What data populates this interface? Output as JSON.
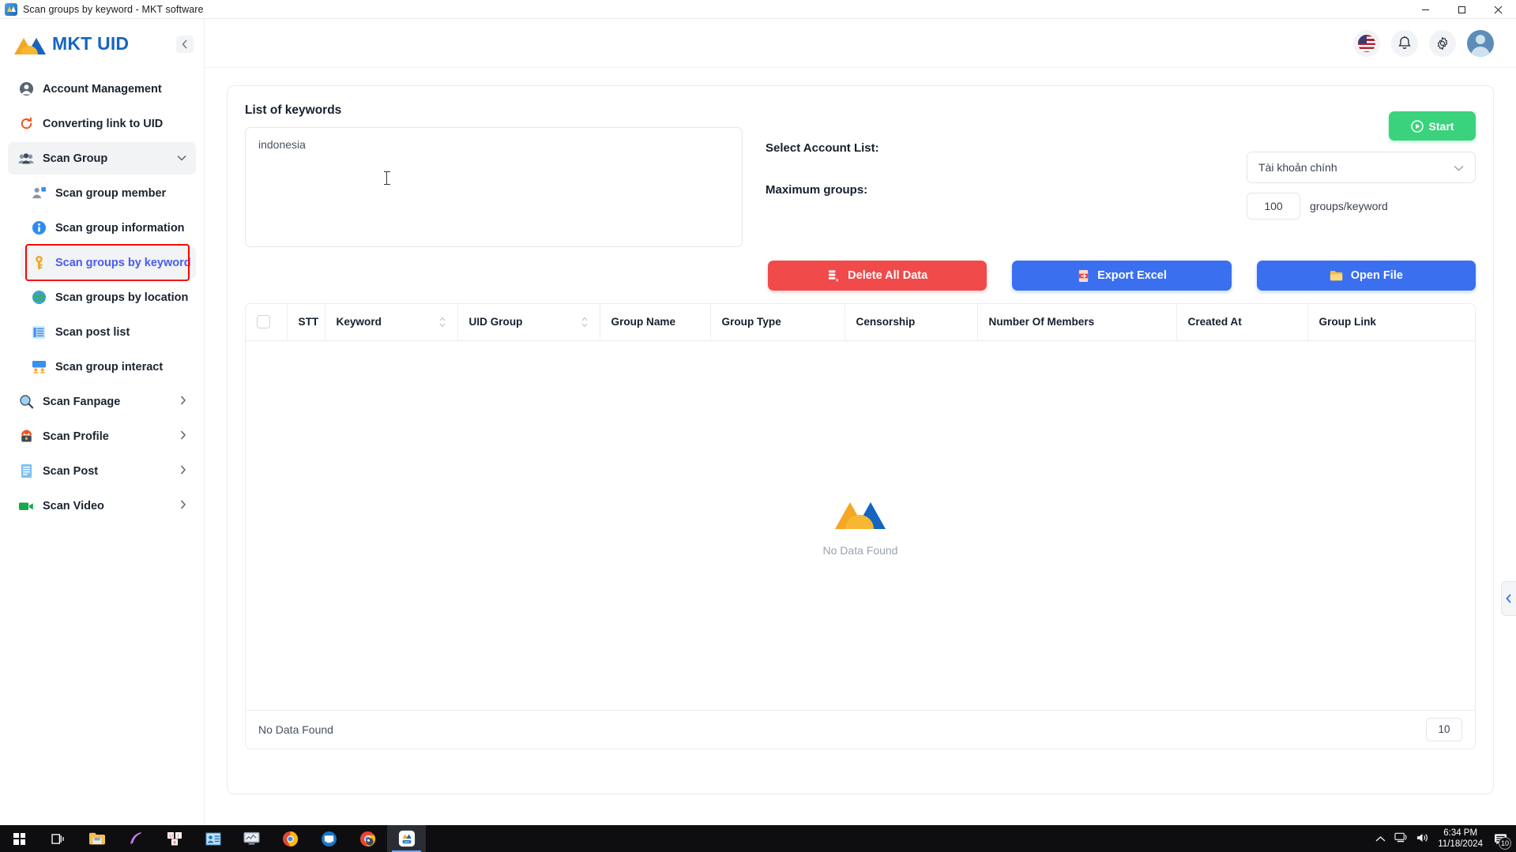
{
  "window": {
    "title": "Scan groups by keyword - MKT software",
    "icon": "app-icon",
    "controls": {
      "minimize": "–",
      "maximize": "□",
      "close": "✕"
    }
  },
  "sidebar": {
    "brand": "MKT UID",
    "collapse_icon": "chevron-left-icon",
    "items": [
      {
        "label": "Account Management",
        "icon": "user-circle-icon",
        "level": "top",
        "state": "normal"
      },
      {
        "label": "Converting link to UID",
        "icon": "refresh-icon",
        "level": "top",
        "state": "normal"
      },
      {
        "label": "Scan Group",
        "icon": "group-icon",
        "level": "top",
        "state": "expanded",
        "chevron": "chevron-down-icon"
      },
      {
        "label": "Scan group member",
        "icon": "user-plus-icon",
        "level": "sub",
        "state": "normal"
      },
      {
        "label": "Scan group information",
        "icon": "info-icon",
        "level": "sub",
        "state": "normal"
      },
      {
        "label": "Scan groups by keyword",
        "icon": "key-icon",
        "level": "sub",
        "state": "selected"
      },
      {
        "label": "Scan groups by location",
        "icon": "globe-icon",
        "level": "sub",
        "state": "normal"
      },
      {
        "label": "Scan post list",
        "icon": "list-icon",
        "level": "sub",
        "state": "normal"
      },
      {
        "label": "Scan group interact",
        "icon": "interact-icon",
        "level": "sub",
        "state": "normal"
      },
      {
        "label": "Scan Fanpage",
        "icon": "magnifier-icon",
        "level": "top",
        "state": "collapsed",
        "chevron": "chevron-right-icon"
      },
      {
        "label": "Scan Profile",
        "icon": "profile-lock-icon",
        "level": "top",
        "state": "collapsed",
        "chevron": "chevron-right-icon"
      },
      {
        "label": "Scan Post",
        "icon": "document-icon",
        "level": "top",
        "state": "collapsed",
        "chevron": "chevron-right-icon"
      },
      {
        "label": "Scan Video",
        "icon": "video-camera-icon",
        "level": "top",
        "state": "collapsed",
        "chevron": "chevron-right-icon"
      }
    ]
  },
  "topbar": {
    "language_flag": "us-flag-icon",
    "notification_icon": "bell-icon",
    "settings_icon": "gear-icon",
    "avatar_icon": "user-avatar-icon"
  },
  "main": {
    "keywords_title": "List of keywords",
    "keywords_value": "indonesia",
    "account_label": "Select Account List:",
    "account_selected": "Tài khoản chính",
    "account_chevron": "chevron-down-icon",
    "max_groups_label": "Maximum groups:",
    "max_groups_value": "100",
    "max_groups_suffix": "groups/keyword",
    "start_label": "Start",
    "start_icon": "play-circle-icon",
    "buttons": [
      {
        "label": "Delete All Data",
        "icon": "delete-data-icon",
        "color": "#f04a4a"
      },
      {
        "label": "Export Excel",
        "icon": "export-excel-icon",
        "color": "#3a6ff0"
      },
      {
        "label": "Open File",
        "icon": "folder-icon",
        "color": "#3a6ff0"
      }
    ],
    "drawer_handle_icon": "chevron-left-icon"
  },
  "table": {
    "columns": [
      {
        "label": "",
        "type": "checkbox"
      },
      {
        "label": "STT",
        "sortable": false
      },
      {
        "label": "Keyword",
        "sortable": true
      },
      {
        "label": "UID Group",
        "sortable": true
      },
      {
        "label": "Group Name",
        "sortable": false
      },
      {
        "label": "Group Type",
        "sortable": false
      },
      {
        "label": "Censorship",
        "sortable": false
      },
      {
        "label": "Number Of Members",
        "sortable": false
      },
      {
        "label": "Created At",
        "sortable": false
      },
      {
        "label": "Group Link",
        "sortable": false
      }
    ],
    "rows": [],
    "empty_text": "No Data Found",
    "footer_text": "No Data Found",
    "page_size": "10"
  },
  "taskbar": {
    "apps": [
      {
        "name": "start-button",
        "icon": "windows-logo-icon"
      },
      {
        "name": "task-view-button",
        "icon": "task-view-icon"
      },
      {
        "name": "file-explorer",
        "icon": "folder-icon"
      },
      {
        "name": "feather-app",
        "icon": "feather-icon"
      },
      {
        "name": "unikey-app",
        "icon": "unikey-icon"
      },
      {
        "name": "contacts-app",
        "icon": "contacts-icon"
      },
      {
        "name": "monitor-app",
        "icon": "monitor-icon"
      },
      {
        "name": "chrome-browser",
        "icon": "chrome-icon"
      },
      {
        "name": "teamviewer-app",
        "icon": "teamviewer-icon"
      },
      {
        "name": "chrome-secondary",
        "icon": "chrome-alt-icon"
      },
      {
        "name": "mkt-uid-app",
        "icon": "mkt-uid-icon"
      }
    ],
    "tray": {
      "chevron_icon": "chevron-up-icon",
      "network_icon": "network-icon",
      "volume_icon": "volume-icon",
      "time": "6:34 PM",
      "date": "11/18/2024",
      "notification_icon": "action-center-icon",
      "notification_count": "10"
    }
  }
}
